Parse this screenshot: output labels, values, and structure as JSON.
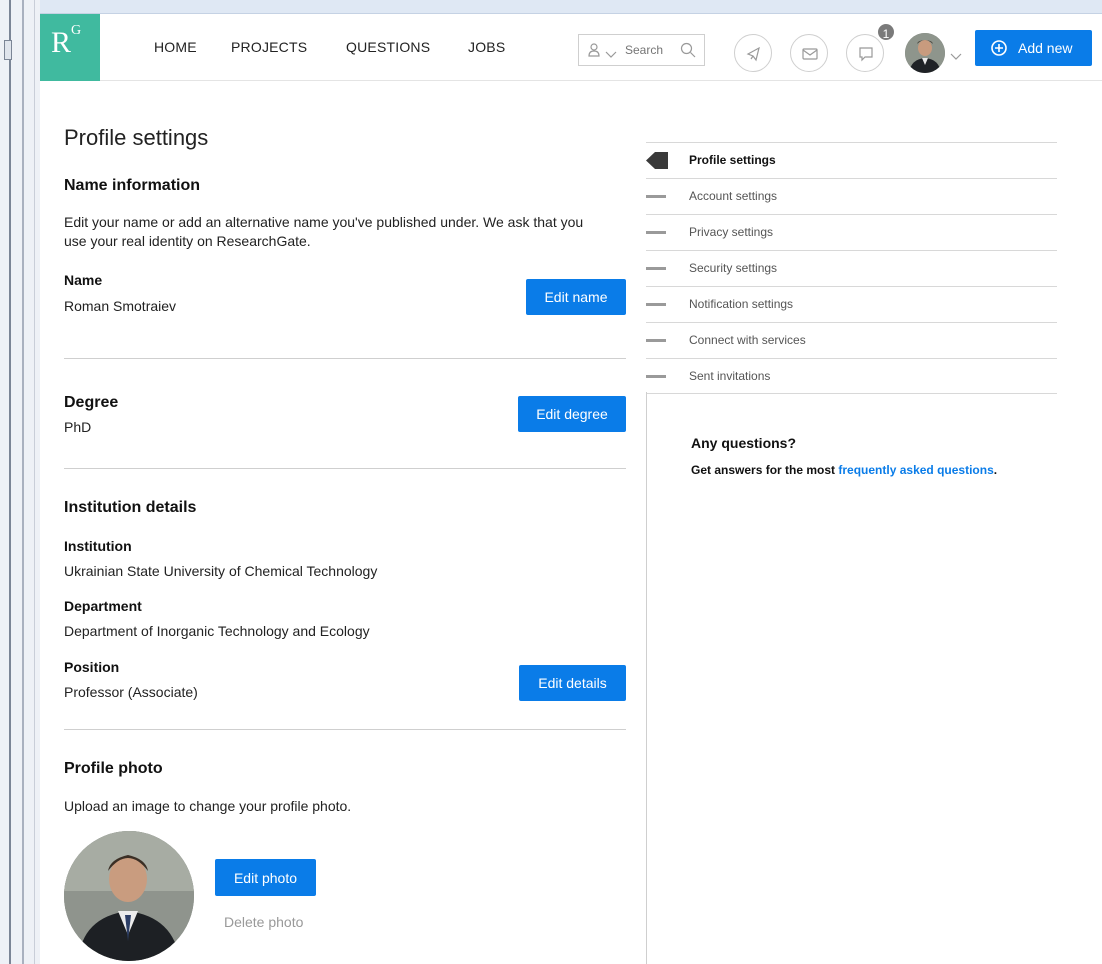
{
  "header": {
    "logo": "R",
    "logo_sup": "G",
    "nav": [
      "HOME",
      "PROJECTS",
      "QUESTIONS",
      "JOBS"
    ],
    "search_placeholder": "Search",
    "notification_count": "1",
    "add_new_label": "Add new"
  },
  "main": {
    "page_title": "Profile settings",
    "name_section": {
      "heading": "Name information",
      "description_line1": "Edit your name or add an alternative name you've published under. We ask that you",
      "description_line2": "use your real identity on ResearchGate.",
      "label": "Name",
      "value": "Roman Smotraiev",
      "button": "Edit name"
    },
    "degree_section": {
      "heading": "Degree",
      "value": "PhD",
      "button": "Edit degree"
    },
    "institution_section": {
      "heading": "Institution details",
      "institution_label": "Institution",
      "institution_value": "Ukrainian State University of Chemical Technology",
      "department_label": "Department",
      "department_value": "Department of Inorganic Technology and Ecology",
      "position_label": "Position",
      "position_value": "Professor (Associate)",
      "button": "Edit details"
    },
    "photo_section": {
      "heading": "Profile photo",
      "description": "Upload an image to change your profile photo.",
      "edit_button": "Edit photo",
      "delete_link": "Delete photo"
    }
  },
  "sidebar": {
    "items": [
      {
        "label": "Profile settings",
        "active": true
      },
      {
        "label": "Account settings",
        "active": false
      },
      {
        "label": "Privacy settings",
        "active": false
      },
      {
        "label": "Security settings",
        "active": false
      },
      {
        "label": "Notification settings",
        "active": false
      },
      {
        "label": "Connect with services",
        "active": false
      },
      {
        "label": "Sent invitations",
        "active": false
      }
    ],
    "faq_title": "Any questions?",
    "faq_prefix": "Get answers for the most ",
    "faq_link": "frequently asked questions",
    "faq_suffix": "."
  },
  "colors": {
    "brand": "#40ba9f",
    "accent": "#0a7ce8"
  },
  "icons": [
    "person-icon",
    "chevron-down-icon",
    "search-icon",
    "announcement-icon",
    "mail-icon",
    "chat-icon",
    "add-circle-icon"
  ]
}
